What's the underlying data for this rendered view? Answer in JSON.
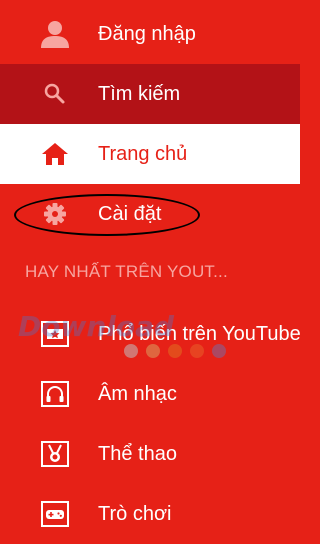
{
  "colors": {
    "background": "#e62117",
    "selected_dark": "#b31217",
    "active_bg": "#ffffff",
    "active_text": "#e62117",
    "section_text": "#f7a5a0"
  },
  "menu": {
    "items": [
      {
        "label": "Đăng nhập",
        "icon": "person-icon"
      },
      {
        "label": "Tìm kiếm",
        "icon": "search-icon"
      },
      {
        "label": "Trang chủ",
        "icon": "home-icon",
        "active": true
      },
      {
        "label": "Cài đặt",
        "icon": "gear-icon"
      }
    ],
    "section_header": "HAY NHẤT TRÊN YOUT...",
    "channels": [
      {
        "label": "Phổ biến trên YouTube",
        "icon": "popular-icon"
      },
      {
        "label": "Âm nhạc",
        "icon": "headphones-icon"
      },
      {
        "label": "Thể thao",
        "icon": "medal-icon"
      },
      {
        "label": "Trò chơi",
        "icon": "gamepad-icon"
      }
    ]
  },
  "overlay": {
    "watermark_text": "Download",
    "watermark_dot_colors": [
      "#c0c0c0",
      "#d8a060",
      "#e07020",
      "#e8602a",
      "#7a6aa0"
    ]
  }
}
